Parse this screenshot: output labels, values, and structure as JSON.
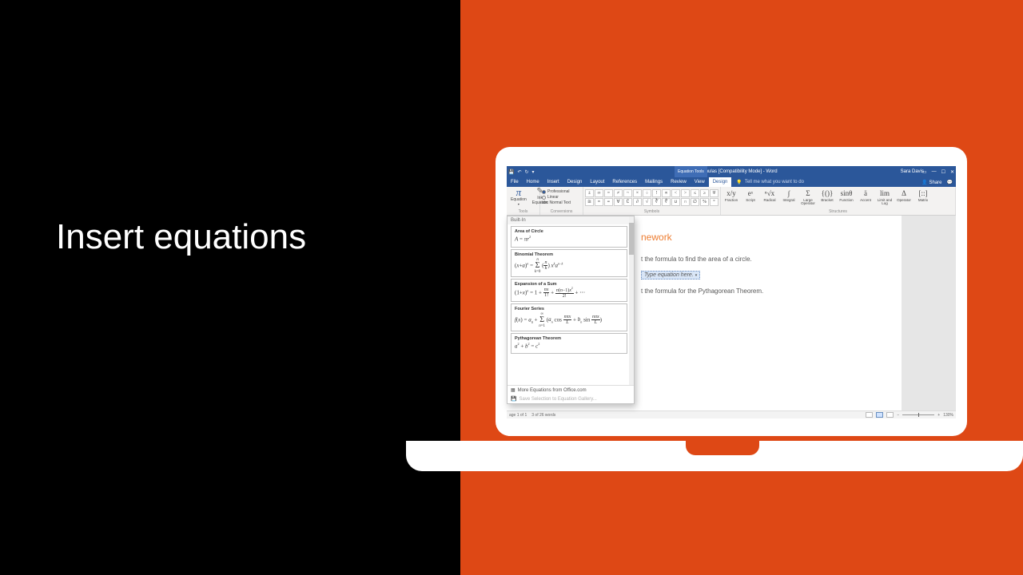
{
  "headline": "Insert equations",
  "titlebar": {
    "doc_title": "math_formulas [Compatibility Mode] - Word",
    "tools_tab": "Equation Tools",
    "user": "Sara Davis"
  },
  "tabs": {
    "file": "File",
    "home": "Home",
    "insert": "Insert",
    "design_doc": "Design",
    "layout": "Layout",
    "references": "References",
    "mailings": "Mailings",
    "review": "Review",
    "view": "View",
    "design_eq": "Design",
    "tell_me": "Tell me what you want to do",
    "share": "Share"
  },
  "ribbon": {
    "tools": {
      "equation": "Equation",
      "ink": "Ink Equation",
      "label": "Tools"
    },
    "conversions": {
      "professional": "Professional",
      "linear": "Linear",
      "normal_text": "abc Normal Text",
      "label": "Conversions"
    },
    "symbols": {
      "label": "Symbols",
      "row1": [
        "±",
        "∞",
        "=",
        "≠",
        "~",
        "×",
        "÷",
        "!",
        "∝",
        "<",
        ">",
        "≤",
        "≥",
        "∓"
      ],
      "row2": [
        "≅",
        "≈",
        "≡",
        "∀",
        "∁",
        "∂",
        "√",
        "∛",
        "∜",
        "∪",
        "∩",
        "∅",
        "%",
        "°"
      ]
    },
    "structures": {
      "label": "Structures",
      "items": [
        {
          "icon": "x/y",
          "label": "Fraction"
        },
        {
          "icon": "eˣ",
          "label": "Script"
        },
        {
          "icon": "ⁿ√x",
          "label": "Radical"
        },
        {
          "icon": "∫",
          "label": "Integral"
        },
        {
          "icon": "Σ",
          "label": "Large Operator"
        },
        {
          "icon": "{()}",
          "label": "Bracket"
        },
        {
          "icon": "sinθ",
          "label": "Function"
        },
        {
          "icon": "ä",
          "label": "Accent"
        },
        {
          "icon": "lim",
          "label": "Limit and Log"
        },
        {
          "icon": "Δ",
          "label": "Operator"
        },
        {
          "icon": "[::]",
          "label": "Matrix"
        }
      ]
    }
  },
  "gallery": {
    "built_in": "Built-In",
    "items": [
      {
        "name": "Area of Circle",
        "formula": "A = πr²"
      },
      {
        "name": "Binomial Theorem",
        "formula": "(x+a)ⁿ = Σₖ (ⁿₖ) xᵏaⁿ⁻ᵏ"
      },
      {
        "name": "Expansion of a Sum",
        "formula": "(1+x)ⁿ = 1 + nx/1! + n(n−1)x²/2! + ⋯"
      },
      {
        "name": "Fourier Series",
        "formula": "f(x) = a₀ + Σₙ (aₙ cos nπx/L + bₙ sin nπx/L)"
      },
      {
        "name": "Pythagorean Theorem",
        "formula": "a² + b² = c²"
      }
    ],
    "more": "More Equations from Office.com",
    "save": "Save Selection to Equation Gallery..."
  },
  "page": {
    "heading_visible": "nework",
    "task1": "t the formula to find the area of a circle.",
    "eq_placeholder": "Type equation here.",
    "task2": "t the formula for the Pythagorean Theorem."
  },
  "statusbar": {
    "page": "age 1 of 1",
    "words": "3 of 26 words",
    "zoom": "130%"
  }
}
